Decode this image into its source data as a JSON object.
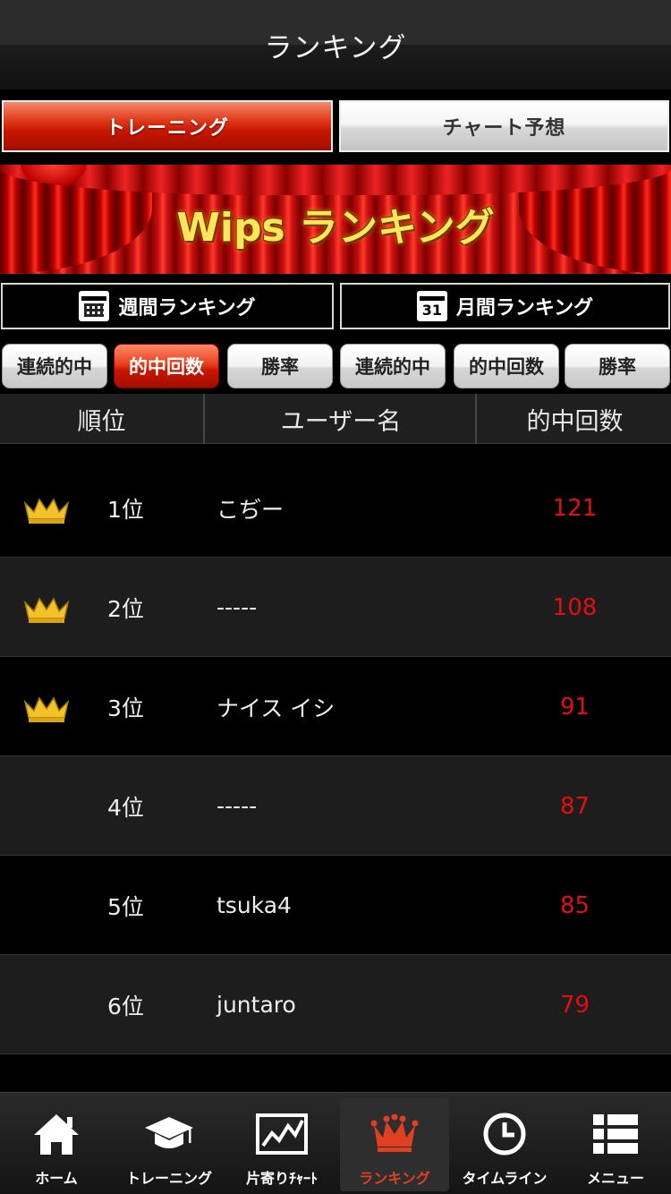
{
  "header": {
    "title": "ランキング"
  },
  "mode_tabs": [
    {
      "label": "トレーニング",
      "selected": true
    },
    {
      "label": "チャート予想",
      "selected": false
    }
  ],
  "banner": {
    "title": "Wips ランキング"
  },
  "period_buttons": {
    "weekly": {
      "label": "週間ランキング",
      "icon": "calendar-icon"
    },
    "monthly": {
      "label": "月間ランキング",
      "icon": "calendar-31-icon",
      "icon_text": "31"
    }
  },
  "sort_buttons": [
    {
      "label": "連続的中",
      "selected": false
    },
    {
      "label": "的中回数",
      "selected": true
    },
    {
      "label": "勝率",
      "selected": false
    },
    {
      "label": "連続的中",
      "selected": false
    },
    {
      "label": "的中回数",
      "selected": false
    },
    {
      "label": "勝率",
      "selected": false
    }
  ],
  "table": {
    "headers": {
      "rank": "順位",
      "user": "ユーザー名",
      "hits": "的中回数"
    },
    "rows": [
      {
        "rank": "1位",
        "user": "こぢー",
        "hits": "121",
        "crown": true
      },
      {
        "rank": "2位",
        "user": "-----",
        "hits": "108",
        "crown": true
      },
      {
        "rank": "3位",
        "user": "ナイス イシ",
        "hits": "91",
        "crown": true
      },
      {
        "rank": "4位",
        "user": "-----",
        "hits": "87",
        "crown": false
      },
      {
        "rank": "5位",
        "user": "tsuka4",
        "hits": "85",
        "crown": false
      },
      {
        "rank": "6位",
        "user": "juntaro",
        "hits": "79",
        "crown": false
      }
    ]
  },
  "bottom_nav": [
    {
      "label": "ホーム",
      "icon": "home-icon",
      "selected": false
    },
    {
      "label": "トレーニング",
      "icon": "graduation-cap-icon",
      "selected": false
    },
    {
      "label": "片寄りﾁｬｰﾄ",
      "icon": "line-chart-icon",
      "selected": false
    },
    {
      "label": "ランキング",
      "icon": "crown-icon",
      "selected": true
    },
    {
      "label": "タイムライン",
      "icon": "clock-icon",
      "selected": false
    },
    {
      "label": "メニュー",
      "icon": "list-icon",
      "selected": false
    }
  ],
  "colors": {
    "accent": "#d82a10",
    "hits_text": "#e01010",
    "crown_gold": "#f2c22a"
  }
}
